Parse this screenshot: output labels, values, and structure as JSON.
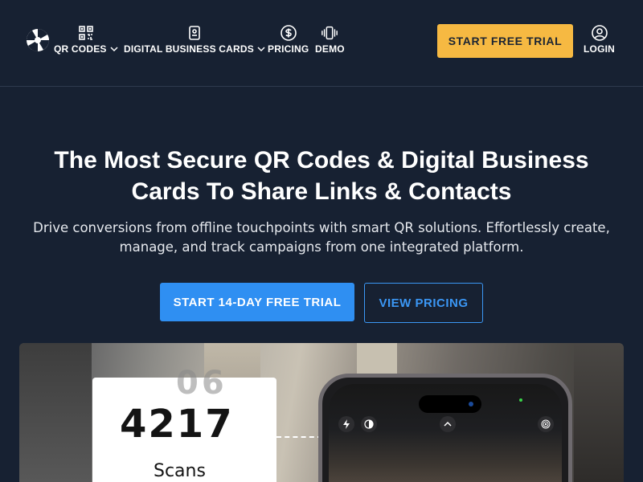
{
  "nav": {
    "items": [
      {
        "label": "QR CODES",
        "icon": "qr-code-icon",
        "dropdown": true
      },
      {
        "label": "DIGITAL BUSINESS CARDS",
        "icon": "business-card-icon",
        "dropdown": true
      },
      {
        "label": "PRICING",
        "icon": "dollar-icon",
        "dropdown": false
      },
      {
        "label": "DEMO",
        "icon": "vibrate-phone-icon",
        "dropdown": false
      }
    ],
    "cta_label": "START FREE TRIAL",
    "login_label": "LOGIN"
  },
  "hero": {
    "title": "The Most Secure QR Codes & Digital Business Cards To Share Links & Contacts",
    "subtitle": "Drive conversions from offline touchpoints with smart QR solutions. Effortlessly create, manage, and track campaigns from one integrated platform.",
    "primary_button": "START 14-DAY FREE TRIAL",
    "secondary_button": "VIEW PRICING"
  },
  "illustration": {
    "scan_count": "4217",
    "scan_ghost": "06",
    "scan_label": "Scans"
  },
  "colors": {
    "background": "#172132",
    "accent_yellow": "#f6b942",
    "accent_blue": "#2f8ff2"
  }
}
